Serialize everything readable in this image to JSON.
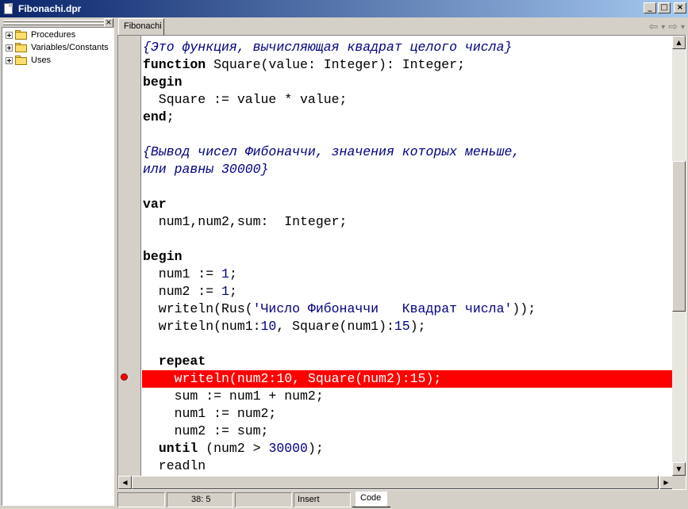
{
  "window": {
    "title": "Fibonachi.dpr",
    "minimize": "_",
    "maximize": "□",
    "close": "×"
  },
  "tree": {
    "close": "×",
    "items": [
      {
        "label": "Procedures"
      },
      {
        "label": "Variables/Constants"
      },
      {
        "label": "Uses"
      }
    ]
  },
  "editor": {
    "tab": "Fibonachi",
    "nav_back": "⇦",
    "nav_back_drop": "▾",
    "nav_fwd": "⇨",
    "nav_fwd_drop": "▾",
    "lines": [
      [
        [
          "cm",
          "{Это функция, вычисляющая квадрат целого числа}"
        ]
      ],
      [
        [
          "kw",
          "function"
        ],
        [
          "t",
          " Square(value: Integer): Integer;"
        ]
      ],
      [
        [
          "kw",
          "begin"
        ]
      ],
      [
        [
          "t",
          "  Square := value * value;"
        ]
      ],
      [
        [
          "kw",
          "end"
        ],
        [
          "t",
          ";"
        ]
      ],
      [
        [
          "t",
          ""
        ]
      ],
      [
        [
          "cm",
          "{Вывод чисел Фибоначчи, значения которых меньше,"
        ]
      ],
      [
        [
          "cm",
          "или равны 30000}"
        ]
      ],
      [
        [
          "t",
          ""
        ]
      ],
      [
        [
          "kw",
          "var"
        ]
      ],
      [
        [
          "t",
          "  num1,num2,sum:  Integer;"
        ]
      ],
      [
        [
          "t",
          ""
        ]
      ],
      [
        [
          "kw",
          "begin"
        ]
      ],
      [
        [
          "t",
          "  num1 := "
        ],
        [
          "num",
          "1"
        ],
        [
          "t",
          ";"
        ]
      ],
      [
        [
          "t",
          "  num2 := "
        ],
        [
          "num",
          "1"
        ],
        [
          "t",
          ";"
        ]
      ],
      [
        [
          "t",
          "  writeln(Rus("
        ],
        [
          "str",
          "'Число Фибоначчи   Квадрат числа'"
        ],
        [
          "t",
          "));"
        ]
      ],
      [
        [
          "t",
          "  writeln(num1:"
        ],
        [
          "num",
          "10"
        ],
        [
          "t",
          ", Square(num1):"
        ],
        [
          "num",
          "15"
        ],
        [
          "t",
          ");"
        ]
      ],
      [
        [
          "t",
          ""
        ]
      ],
      [
        [
          "t",
          "  "
        ],
        [
          "kw",
          "repeat"
        ]
      ],
      [
        [
          "t",
          "    writeln(num2:10, Square(num2):15);"
        ]
      ],
      [
        [
          "t",
          "    sum := num1 + num2;"
        ]
      ],
      [
        [
          "t",
          "    num1 := num2;"
        ]
      ],
      [
        [
          "t",
          "    num2 := sum;"
        ]
      ],
      [
        [
          "t",
          "  "
        ],
        [
          "kw",
          "until"
        ],
        [
          "t",
          " (num2 > "
        ],
        [
          "num",
          "30000"
        ],
        [
          "t",
          ");"
        ]
      ],
      [
        [
          "t",
          "  readln"
        ]
      ]
    ],
    "highlighted_line": 19
  },
  "statusbar": {
    "position": "38:  5",
    "mode": "Insert",
    "view_tab": "Code"
  }
}
